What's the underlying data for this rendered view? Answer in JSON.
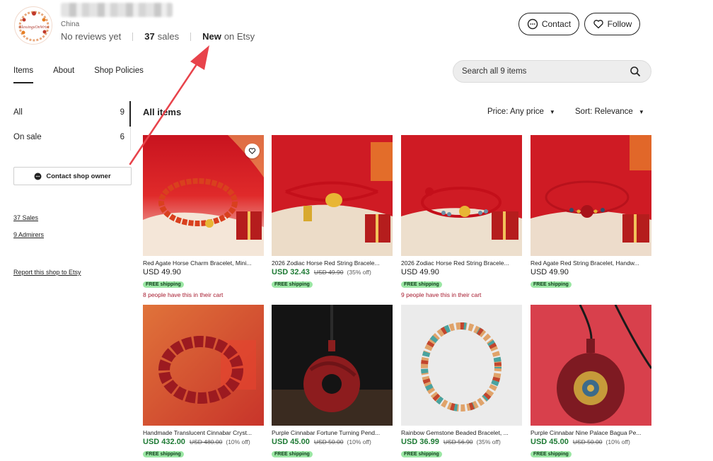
{
  "shop": {
    "logo_text": "BlessingsOnWrist",
    "location": "China",
    "reviews": "No reviews yet",
    "sales_count": "37",
    "sales_label": "sales",
    "new_strong": "New",
    "new_rest": "on Etsy"
  },
  "actions": {
    "contact": "Contact",
    "follow": "Follow"
  },
  "tabs": [
    {
      "label": "Items"
    },
    {
      "label": "About"
    },
    {
      "label": "Shop Policies"
    }
  ],
  "search": {
    "placeholder": "Search all 9 items"
  },
  "sidebar": {
    "items": [
      {
        "label": "All",
        "count": "9"
      },
      {
        "label": "On sale",
        "count": "6"
      }
    ],
    "contact_owner": "Contact shop owner",
    "links": [
      "37 Sales",
      "9 Admirers"
    ],
    "report": "Report this shop to Etsy"
  },
  "listing": {
    "heading": "All items",
    "price_filter": "Price: Any price",
    "sort_filter": "Sort: Relevance"
  },
  "products": [
    {
      "title": "Red Agate Horse Charm Bracelet, Mini...",
      "price": "USD 49.90",
      "original": "",
      "discount": "",
      "shipping": "FREE shipping",
      "cart_note": "8 people have this in their cart"
    },
    {
      "title": "2026 Zodiac Horse Red String Bracele...",
      "price": "USD 32.43",
      "original": "USD 49.90",
      "discount": "(35% off)",
      "shipping": "FREE shipping",
      "cart_note": ""
    },
    {
      "title": "2026 Zodiac Horse Red String Bracele...",
      "price": "USD 49.90",
      "original": "",
      "discount": "",
      "shipping": "FREE shipping",
      "cart_note": "9 people have this in their cart"
    },
    {
      "title": "Red Agate Red String Bracelet, Handw...",
      "price": "USD 49.90",
      "original": "",
      "discount": "",
      "shipping": "FREE shipping",
      "cart_note": ""
    },
    {
      "title": "Handmade Translucent Cinnabar Cryst...",
      "price": "USD 432.00",
      "original": "USD 480.00",
      "discount": "(10% off)",
      "shipping": "FREE shipping",
      "cart_note": ""
    },
    {
      "title": "Purple Cinnabar Fortune Turning Pend...",
      "price": "USD 45.00",
      "original": "USD 50.00",
      "discount": "(10% off)",
      "shipping": "FREE shipping",
      "cart_note": ""
    },
    {
      "title": "Rainbow Gemstone Beaded Bracelet, ...",
      "price": "USD 36.99",
      "original": "USD 56.90",
      "discount": "(35% off)",
      "shipping": "FREE shipping",
      "cart_note": ""
    },
    {
      "title": "Purple Cinnabar Nine Palace Bagua Pe...",
      "price": "USD 45.00",
      "original": "USD 50.00",
      "discount": "(10% off)",
      "shipping": "FREE shipping",
      "cart_note": ""
    }
  ],
  "colors": {
    "sale_green": "#1e7a34",
    "cart_red": "#a61a2e",
    "shipping_badge": "#9be7a4",
    "annotation_red": "#e8434b"
  }
}
